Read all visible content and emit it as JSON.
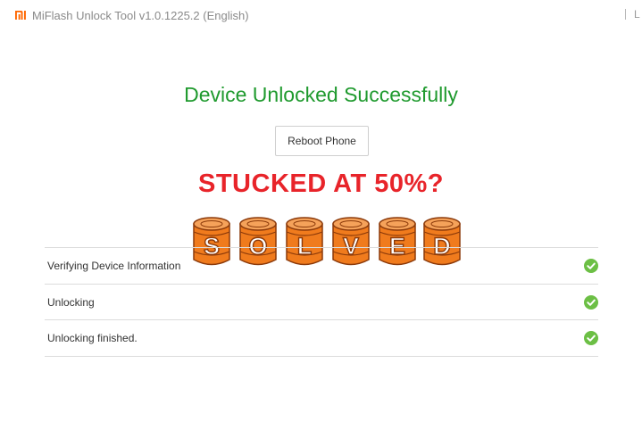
{
  "window": {
    "title": "MiFlash Unlock Tool v1.0.1225.2 (English)",
    "logo_icon": "mi-logo-icon",
    "right_edge_text": "L",
    "colors": {
      "logo": "#ff6700",
      "title_text": "#8a8a8a"
    }
  },
  "status": {
    "title": "Device Unlocked Successfully",
    "color": "#1f9a2e"
  },
  "actions": {
    "reboot_label": "Reboot Phone"
  },
  "overlay": {
    "headline": "STUCKED AT 50%?",
    "headline_color": "#e8242a",
    "badge_letters": [
      "S",
      "O",
      "L",
      "V",
      "E",
      "D"
    ],
    "badge_color": "#f07b1d"
  },
  "steps": [
    {
      "label": "Verifying Device Information",
      "status_icon": "check-circle-icon"
    },
    {
      "label": "Unlocking",
      "status_icon": "check-circle-icon"
    },
    {
      "label": "Unlocking finished.",
      "status_icon": "check-circle-icon"
    }
  ],
  "colors": {
    "check": "#6cbf45",
    "divider": "#dcdcdc"
  }
}
